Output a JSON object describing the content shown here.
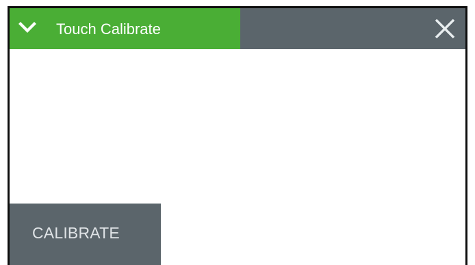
{
  "header": {
    "title": "Touch Calibrate",
    "expand_icon": "chevron-down-icon",
    "close_icon": "close-icon",
    "title_bg": "#4aae35",
    "bar_bg": "#5b656b"
  },
  "actions": {
    "calibrate_label": "CALIBRATE",
    "button_bg": "#5b656b"
  }
}
